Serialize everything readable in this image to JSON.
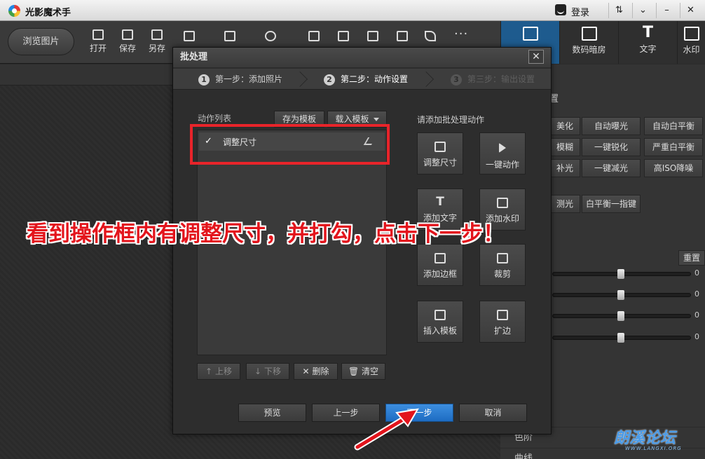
{
  "app": {
    "title": "光影魔术手",
    "login": "登录"
  },
  "window_buttons": [
    "⇅",
    "⌄",
    "–",
    "✕"
  ],
  "toolbar": {
    "browse": "浏览图片",
    "open": "打开",
    "save": "保存",
    "save_as": "另存",
    "more": "···"
  },
  "right_tabs": [
    {
      "label": "",
      "icon": "edit-icon"
    },
    {
      "label": "数码暗房",
      "icon": "camera-icon"
    },
    {
      "label": "文字",
      "icon": "text-icon"
    },
    {
      "label": "水印",
      "icon": "watermark-icon"
    }
  ],
  "right_panel": {
    "section_title": "置",
    "buttons_row1": [
      "美化",
      "自动曝光",
      "自动白平衡"
    ],
    "buttons_row2": [
      "模糊",
      "一键锐化",
      "严重白平衡"
    ],
    "buttons_row3": [
      "补光",
      "一键减光",
      "高ISO降噪"
    ],
    "buttons_row4": [
      "测光",
      "白平衡一指键"
    ],
    "reset": "重置",
    "slider_values": [
      "0",
      "0",
      "0",
      "0"
    ],
    "sections": [
      "色阶",
      "曲线"
    ]
  },
  "dialog": {
    "title": "批处理",
    "close": "✕",
    "steps": [
      {
        "num": "1",
        "label": "第一步：添加照片",
        "state": "done"
      },
      {
        "num": "2",
        "label": "第二步：动作设置",
        "state": "current"
      },
      {
        "num": "3",
        "label": "第三步：输出设置",
        "state": "future"
      }
    ],
    "list_label": "动作列表",
    "save_template": "存为模板",
    "load_template": "载入模板",
    "actions": [
      {
        "label": "调整尺寸",
        "checked": true
      }
    ],
    "list_buttons": [
      {
        "label": "上移",
        "icon": "↑",
        "enabled": false
      },
      {
        "label": "下移",
        "icon": "↓",
        "enabled": false
      },
      {
        "label": "删除",
        "icon": "✕",
        "enabled": true
      },
      {
        "label": "清空",
        "icon": "🗑",
        "enabled": true
      }
    ],
    "add_label": "请添加批处理动作",
    "tiles": [
      {
        "label": "调整尺寸",
        "icon": "resize-icon"
      },
      {
        "label": "一键动作",
        "icon": "play-icon"
      },
      {
        "label": "添加文字",
        "icon": "text-icon"
      },
      {
        "label": "添加水印",
        "icon": "watermark-icon"
      },
      {
        "label": "添加边框",
        "icon": "frame-icon"
      },
      {
        "label": "裁剪",
        "icon": "crop-icon"
      },
      {
        "label": "插入模板",
        "icon": "template-icon"
      },
      {
        "label": "扩边",
        "icon": "expand-icon"
      }
    ],
    "footer": {
      "preview": "预览",
      "prev": "上一步",
      "next": "下一步",
      "cancel": "取消"
    }
  },
  "annotation": {
    "text": "看到操作框内有调整尺寸，并打勾，点击下一步！",
    "color": "#e3141c"
  },
  "watermark": {
    "text": "朗溪论坛",
    "url": "WWW.LANGXI.ORG"
  }
}
